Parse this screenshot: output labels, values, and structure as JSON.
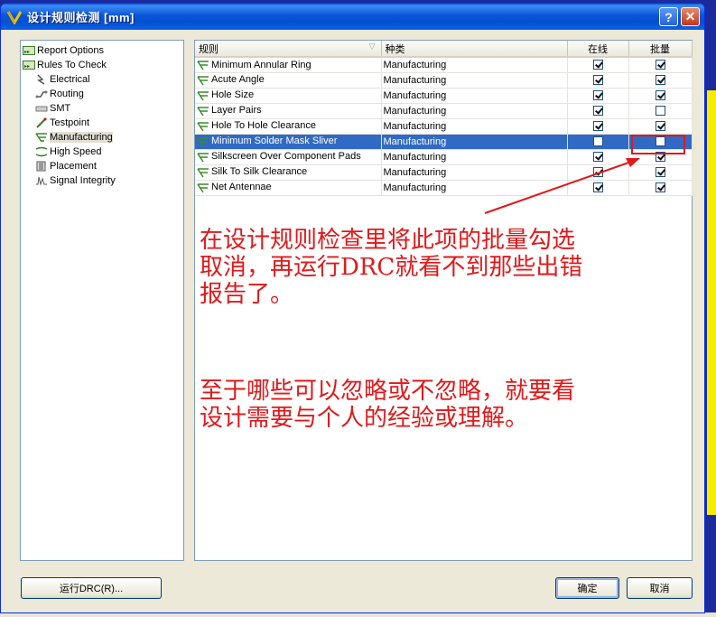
{
  "window": {
    "title": "设计规则检测 [mm]"
  },
  "tree": [
    {
      "label": "Report Options",
      "level": 0,
      "icon": "report-options-icon"
    },
    {
      "label": "Rules To Check",
      "level": 0,
      "icon": "rules-to-check-icon"
    },
    {
      "label": "Electrical",
      "level": 1,
      "icon": "electrical-icon"
    },
    {
      "label": "Routing",
      "level": 1,
      "icon": "routing-icon"
    },
    {
      "label": "SMT",
      "level": 1,
      "icon": "smt-icon"
    },
    {
      "label": "Testpoint",
      "level": 1,
      "icon": "testpoint-icon"
    },
    {
      "label": "Manufacturing",
      "level": 1,
      "icon": "manufacturing-icon",
      "selected": true
    },
    {
      "label": "High Speed",
      "level": 1,
      "icon": "high-speed-icon"
    },
    {
      "label": "Placement",
      "level": 1,
      "icon": "placement-icon"
    },
    {
      "label": "Signal Integrity",
      "level": 1,
      "icon": "signal-integrity-icon"
    }
  ],
  "table": {
    "headers": {
      "rule": "规则",
      "kind": "种类",
      "online": "在线",
      "batch": "批量"
    },
    "rows": [
      {
        "rule": "Minimum Annular Ring",
        "kind": "Manufacturing",
        "online": true,
        "batch": true
      },
      {
        "rule": "Acute Angle",
        "kind": "Manufacturing",
        "online": true,
        "batch": true
      },
      {
        "rule": "Hole Size",
        "kind": "Manufacturing",
        "online": true,
        "batch": true
      },
      {
        "rule": "Layer Pairs",
        "kind": "Manufacturing",
        "online": true,
        "batch": false
      },
      {
        "rule": "Hole To Hole Clearance",
        "kind": "Manufacturing",
        "online": true,
        "batch": true
      },
      {
        "rule": "Minimum Solder Mask Sliver",
        "kind": "Manufacturing",
        "online": false,
        "batch": false,
        "selected": true
      },
      {
        "rule": "Silkscreen Over Component Pads",
        "kind": "Manufacturing",
        "online": true,
        "batch": true
      },
      {
        "rule": "Silk To Silk Clearance",
        "kind": "Manufacturing",
        "online": true,
        "batch": true
      },
      {
        "rule": "Net Antennae",
        "kind": "Manufacturing",
        "online": true,
        "batch": true
      }
    ]
  },
  "annotation": {
    "text1": "在设计规则检查里将此项的批量勾选\n取消，再运行DRC就看不到那些出错\n报告了。",
    "text2": "至于哪些可以忽略或不忽略，就要看\n设计需要与个人的经验或理解。"
  },
  "buttons": {
    "run_drc": "运行DRC(R)...",
    "ok": "确定",
    "cancel": "取消"
  },
  "colors": {
    "annotation": "#e0191b",
    "selection": "#316ac5",
    "titlebar": "#0a56d8"
  }
}
